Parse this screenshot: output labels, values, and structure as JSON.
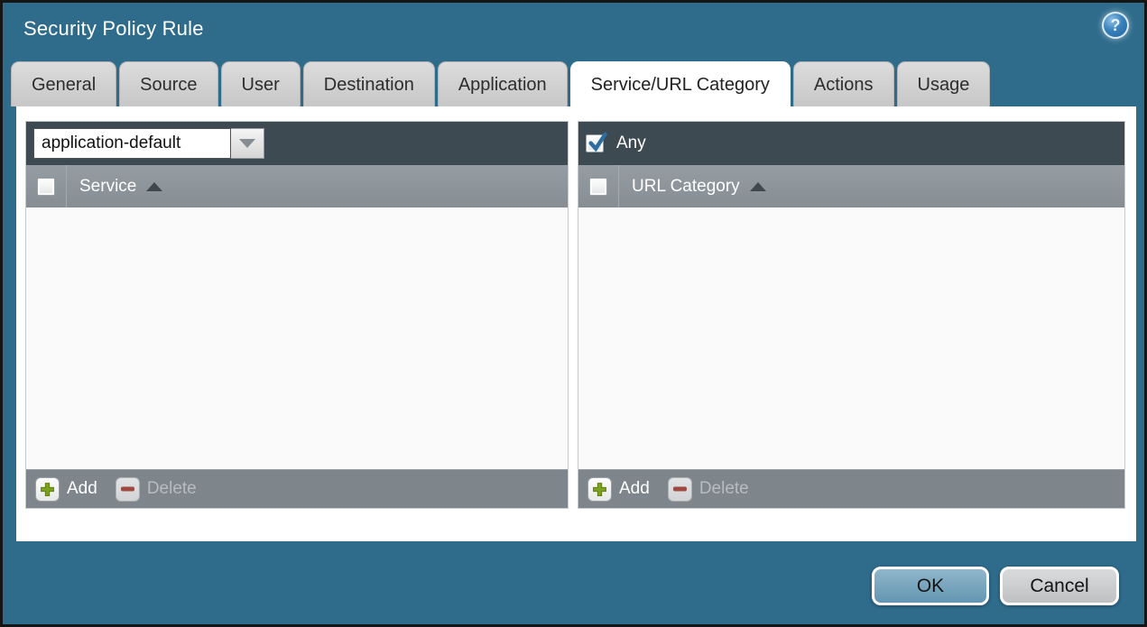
{
  "window": {
    "title": "Security Policy Rule"
  },
  "help": {
    "glyph": "?"
  },
  "tabs": [
    {
      "label": "General",
      "active": false
    },
    {
      "label": "Source",
      "active": false
    },
    {
      "label": "User",
      "active": false
    },
    {
      "label": "Destination",
      "active": false
    },
    {
      "label": "Application",
      "active": false
    },
    {
      "label": "Service/URL Category",
      "active": true
    },
    {
      "label": "Actions",
      "active": false
    },
    {
      "label": "Usage",
      "active": false
    }
  ],
  "service_panel": {
    "service_selector": {
      "value": "application-default"
    },
    "select_all_checked": false,
    "column_header": "Service",
    "sort_direction": "ascending",
    "rows": [],
    "add_label": "Add",
    "delete_label": "Delete",
    "delete_enabled": false
  },
  "url_category_panel": {
    "any_checkbox": {
      "label": "Any",
      "checked": true
    },
    "select_all_checked": false,
    "column_header": "URL Category",
    "sort_direction": "ascending",
    "rows": [],
    "add_label": "Add",
    "delete_label": "Delete",
    "delete_enabled": false
  },
  "action_buttons": {
    "ok_label": "OK",
    "cancel_label": "Cancel"
  },
  "icons": {
    "help": "question-mark-circle",
    "combo_arrow": "chevron-down-triangle",
    "sort": "triangle-up",
    "add": "green-plus",
    "delete": "red-minus",
    "check": "blue-checkmark"
  },
  "colors": {
    "teal_background": "#2f6c8c",
    "dark_header": "#3e4a52",
    "column_header_gray": "#8d959b",
    "footer_bar_gray": "#7e868c",
    "ok_button_blue": "#79a6bd",
    "cancel_button_gray": "#cccdce",
    "add_plus_green": "#7aa21d",
    "delete_minus_red": "#9c4a42",
    "checkbox_check_blue": "#2d6da0"
  }
}
